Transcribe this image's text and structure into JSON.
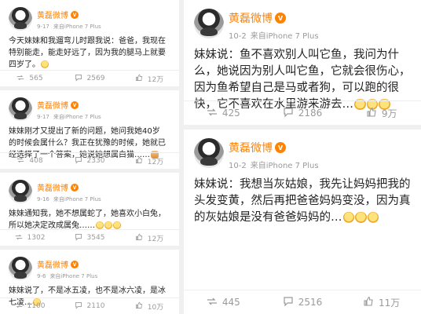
{
  "posts": [
    {
      "name": "黄磊微博",
      "date": "9-17",
      "source": "来自iPhone 7 Plus",
      "text": "今天妹妹和我遛弯儿时跟我说：爸爸，我现在特别能走，能走好远了，因为我的腿马上就要四岁了。",
      "emoji": "smile-emoji",
      "reposts": "565",
      "comments": "2569",
      "likes": "12万"
    },
    {
      "name": "黄磊微博",
      "date": "9-17",
      "source": "来自iPhone 7 Plus",
      "text": "妹妹刚才又提出了新的问题，她问我她40岁的时候会属什么？我正在犹豫的时候，她就已经选择了一个答案，她说她想属白猫……",
      "emoji": "cat-emoji",
      "reposts": "408",
      "comments": "2330",
      "likes": "12万"
    },
    {
      "name": "黄磊微博",
      "date": "9-16",
      "source": "来自iPhone 7 Plus",
      "text": "妹妹通知我，她不想属蛇了，她喜欢小白兔，所以她决定改成属兔……",
      "emoji": "grin-emoji",
      "reposts": "1302",
      "comments": "3545",
      "likes": "12万"
    },
    {
      "name": "黄磊微博",
      "date": "9-6",
      "source": "来自iPhone 7 Plus",
      "text": "妹妹说了，不是冰五凌，也不是冰六凌，是冰七凌…",
      "emoji": "smile-emoji",
      "reposts": "1100",
      "comments": "2110",
      "likes": "10万"
    },
    {
      "name": "黄磊微博",
      "date": "10-2",
      "source": "来自iPhone 7 Plus",
      "text": "妹妹说：鱼不喜欢别人叫它鱼，我问为什么，她说因为别人叫它鱼，它就会很伤心，因为鱼希望自己是马或者狗，可以跑的很快，它不喜欢在水里游来游去…",
      "emoji": "sweat-emoji",
      "reposts": "425",
      "comments": "2186",
      "likes": "9万"
    },
    {
      "name": "黄磊微博",
      "date": "10-2",
      "source": "来自iPhone 7 Plus",
      "text": "妹妹说：我想当灰姑娘，我先让妈妈把我的头发变黄，然后再把爸爸妈妈变没，因为真的灰姑娘是没有爸爸妈妈的…",
      "emoji": "wink-emoji",
      "reposts": "445",
      "comments": "2516",
      "likes": "11万"
    }
  ],
  "colors": {
    "brand": "#ff8200",
    "meta": "#9a9a9a",
    "divider": "#f0f0f0"
  }
}
